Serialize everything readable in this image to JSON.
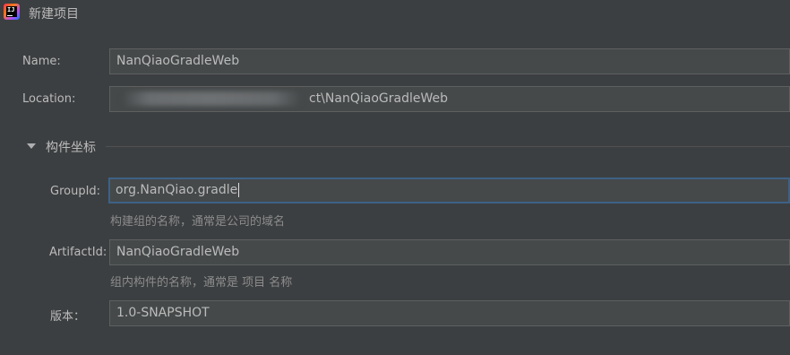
{
  "window": {
    "title": "新建项目",
    "app_icon": "intellij-idea-icon",
    "app_icon_text": "IJ"
  },
  "form": {
    "name_label": "Name:",
    "name_value": "NanQiaoGradleWeb",
    "location_label": "Location:",
    "location_value_visible": "ct\\NanQiaoGradleWeb",
    "section_title": "构件坐标",
    "groupid_label": "GroupId:",
    "groupid_value": "org.NanQiao.gradle",
    "groupid_hint": "构建组的名称，通常是公司的域名",
    "artifactid_label": "ArtifactId:",
    "artifactid_value": "NanQiaoGradleWeb",
    "artifactid_hint": "组内构件的名称，通常是 项目 名称",
    "version_label": "版本：",
    "version_value": "1.0-SNAPSHOT"
  },
  "colors": {
    "background": "#3c3f41",
    "field_bg": "#45494a",
    "focus_border": "#3d6185"
  }
}
